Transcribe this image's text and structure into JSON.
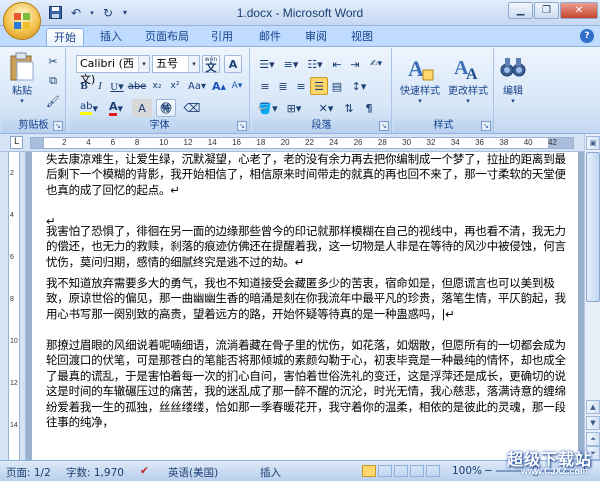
{
  "window": {
    "title": "1.docx - Microsoft Word"
  },
  "tabs": [
    {
      "label": "开始",
      "active": true
    },
    {
      "label": "插入"
    },
    {
      "label": "页面布局"
    },
    {
      "label": "引用"
    },
    {
      "label": "邮件"
    },
    {
      "label": "审阅"
    },
    {
      "label": "视图"
    }
  ],
  "ribbon": {
    "clipboard": {
      "label": "剪贴板",
      "paste_label": "粘贴"
    },
    "font": {
      "label": "字体",
      "font_name": "Calibri (西文)",
      "font_size": "五号",
      "wen_char": "wén",
      "a_char": "A"
    },
    "paragraph": {
      "label": "段落"
    },
    "styles": {
      "label": "样式",
      "quick_styles": "快速样式",
      "change_styles": "更改样式"
    },
    "editing": {
      "label": "编辑"
    }
  },
  "ruler": {
    "numbers": [
      "2",
      "4",
      "6",
      "8",
      "10",
      "12",
      "14",
      "16",
      "18",
      "20",
      "22",
      "24",
      "26",
      "28",
      "30",
      "32",
      "34",
      "36",
      "38",
      "40",
      "42"
    ],
    "tab_selector": "L"
  },
  "document": {
    "paragraphs": [
      "失去康凉难生，让爱生绿，沉默凝望，心老了，老的没有余力再去把你编制成一个梦了，拉扯的距离到最后剩下一个模糊的背影，我开始相信了，相信原来时间带走的就真的再也回不来了，那一寸柔软的天堂便也真的成了回忆的起点。↵",
      "↵",
      "我害怕了恐惧了，徘徊在另一面的边缘那些曾今的印记就那样模糊在自己的视线中，再也看不清，我无力的偿还，也无力的救赎，刹落的痕迹仿佛还在提醒着我，这一切物是人非是在等待的风沙中被侵蚀，何言忧伤，莫问归期，感情的细腻终究是逃不过的劫。↵",
      "我不知道放弃需要多大的勇气，我也不知道接受会藏匿多少的苦衷，宿命如是，但愿谎言也可以美到极致，原谅世俗的偏见，那一曲幽幽生香的暗涌是刻在你我流年中最平凡的珍贵，落笔生情，平仄韵起，我用心书写那一阕别致的高贵，望着远方的路，开始怀疑等待真的是一种蛊惑吗，|↵",
      "那撩过眉眼的风细说着呢喃细语，流淌着藏在骨子里的忧伤，如花落，如烟散，但愿所有的一切都会成为轮回渡口的伏笔，可是那苍白的笔能否将那倾城的素颜勾勒于心，初衷毕竟是一种最纯的情怀，却也成全了最真的谎乱，于是害怕着每一次的扪心自问，害怕着世俗洗礼的变迁，这是浮萍还是成长，更确切的说这是时间的车辙碾压过的痛苦，我的迷乱成了那一醉不醒的沉沦，时光无情，我心慈悲，落满诗意的缠绵纷爱着我一生的孤独，丝丝缕缕，恰如那一季春暖花开，我守着你的温柔，相依的是彼此的灵魂，那一段往事的纯净，"
    ]
  },
  "status": {
    "page": "页面: 1/2",
    "words": "字数: 1,970",
    "language": "英语(美国)",
    "mode": "插入",
    "zoom": "100%",
    "zoom_minus": "−",
    "zoom_plus": "+"
  },
  "watermark": {
    "text": "超级下载站",
    "url": "www.CJXZ.com"
  },
  "colors": {
    "accent": "#15428b",
    "ribbon_bg": "#d6e5f7",
    "titlebar": "#c4d8f2"
  }
}
